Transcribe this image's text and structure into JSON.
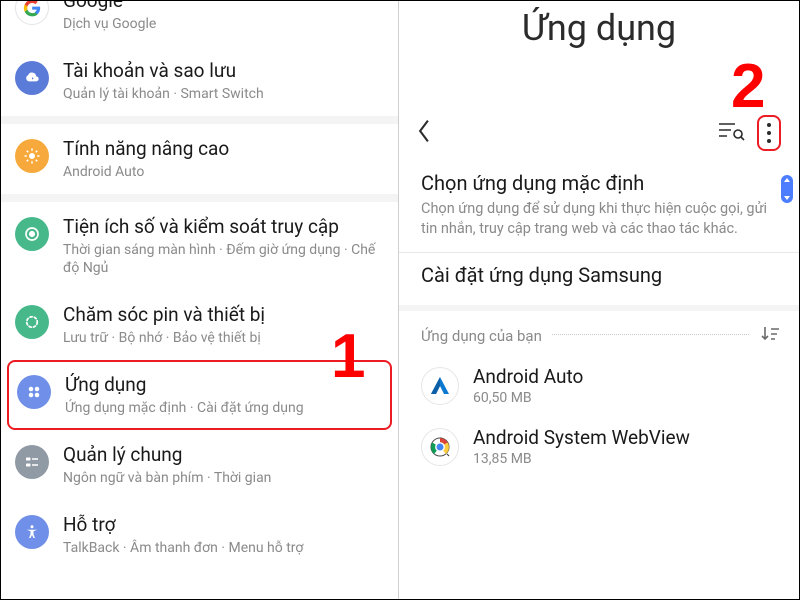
{
  "left": {
    "items": [
      {
        "title": "Google",
        "sub": "Dịch vụ Google"
      },
      {
        "title": "Tài khoản và sao lưu",
        "sub": "Quản lý tài khoản  ·  Smart Switch"
      },
      {
        "title": "Tính năng nâng cao",
        "sub": "Android Auto"
      },
      {
        "title": "Tiện ích số và kiểm soát truy cập",
        "sub": "Thời gian sáng màn hình  ·  Đếm giờ ứng dụng  ·  Chế độ Ngủ"
      },
      {
        "title": "Chăm sóc pin và thiết bị",
        "sub": "Lưu trữ  ·  Bộ nhớ  ·  Bảo vệ thiết bị"
      },
      {
        "title": "Ứng dụng",
        "sub": "Ứng dụng mặc định  ·  Cài đặt ứng dụng"
      },
      {
        "title": "Quản lý chung",
        "sub": "Ngôn ngữ và bàn phím  ·  Thời gian"
      },
      {
        "title": "Hỗ trợ",
        "sub": "TalkBack  ·  Âm thanh đơn  ·  Menu hỗ trợ"
      }
    ]
  },
  "right": {
    "title": "Ứng dụng",
    "default_apps": {
      "title": "Chọn ứng dụng mặc định",
      "sub": "Chọn ứng dụng để sử dụng khi thực hiện cuộc gọi, gửi tin nhắn, truy cập trang web và các thao tác khác."
    },
    "samsung_settings": {
      "title": "Cài đặt ứng dụng Samsung"
    },
    "your_apps_label": "Ứng dụng của bạn",
    "apps": [
      {
        "name": "Android Auto",
        "size": "60,50 MB"
      },
      {
        "name": "Android System WebView",
        "size": "13,85 MB"
      }
    ]
  },
  "annotations": {
    "one": "1",
    "two": "2"
  },
  "colors": {
    "google": "#ffffff",
    "accounts": "#5b7bd9",
    "advanced": "#f7a93b",
    "digital": "#47b88a",
    "battery": "#47b88a",
    "apps": "#6f8fe8",
    "general": "#8f9aa5",
    "support": "#6f8fe8"
  }
}
